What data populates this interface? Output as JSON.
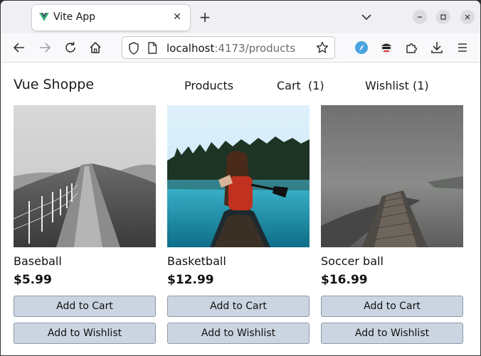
{
  "browser": {
    "tab_title": "Vite App",
    "url_host": "localhost",
    "url_rest": ":4173/products"
  },
  "site": {
    "title": "Vue Shoppe",
    "nav": {
      "products": "Products",
      "cart": "Cart  (1)",
      "wishlist": "Wishlist (1)"
    }
  },
  "products": [
    {
      "name": "Baseball",
      "price": "$5.99",
      "add_cart": "Add to Cart",
      "add_wishlist": "Add to Wishlist",
      "image": "foggy-hill-path-photo"
    },
    {
      "name": "Basketball",
      "price": "$12.99",
      "add_cart": "Add to Cart",
      "add_wishlist": "Add to Wishlist",
      "image": "woman-in-canoe-lake-photo"
    },
    {
      "name": "Soccer ball",
      "price": "$16.99",
      "add_cart": "Add to Cart",
      "add_wishlist": "Add to Wishlist",
      "image": "foggy-pier-photo"
    }
  ],
  "colors": {
    "button_bg": "#cbd5e1",
    "vue_green": "#41b883",
    "vue_dark": "#35495e"
  }
}
